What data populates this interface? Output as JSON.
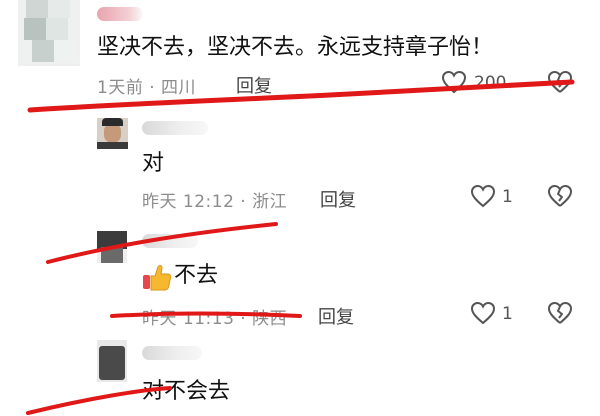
{
  "comments": [
    {
      "text": "坚决不去，坚决不去。永远支持章子怡！",
      "meta": "1天前 · 四川",
      "reply_label": "回复",
      "likes": "200"
    },
    {
      "text": "对",
      "meta": "昨天 12:12 · 浙江",
      "reply_label": "回复",
      "likes": "1"
    },
    {
      "text": "不去",
      "emoji": "thumbs-up",
      "meta": "昨天 11:13 · 陕西",
      "reply_label": "回复",
      "likes": "1"
    },
    {
      "text": "对不会去"
    }
  ],
  "colors": {
    "annotation_red": "#e01818",
    "meta_gray": "#8c8c8c"
  },
  "icons": [
    "heart-icon",
    "broken-heart-icon",
    "thumbs-up-emoji"
  ]
}
